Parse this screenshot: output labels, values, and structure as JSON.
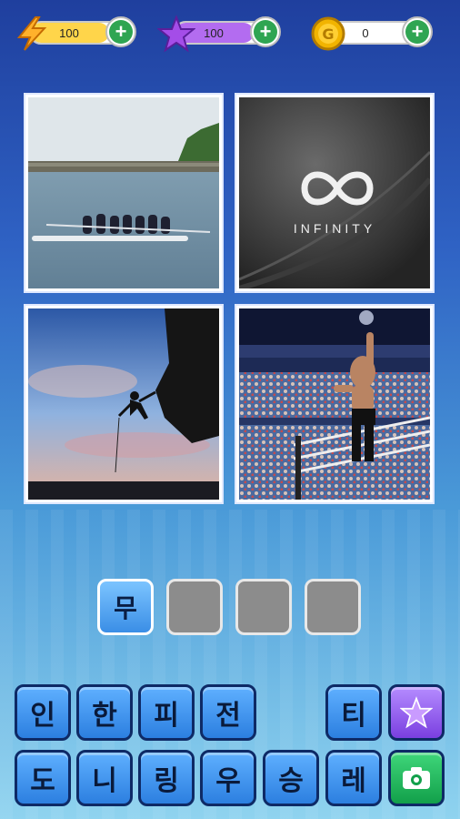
{
  "counters": [
    {
      "icon": "lightning-bolt-icon",
      "value": "100",
      "fill_percent": 80,
      "color": "#ffd54a",
      "icon_color": "#ffb12b"
    },
    {
      "icon": "star-icon",
      "value": "100",
      "fill_percent": 80,
      "color": "#b36cf0",
      "icon_color": "#a44de8"
    },
    {
      "icon": "coin-icon",
      "value": "0",
      "fill_percent": 10,
      "color": "#ffe083",
      "icon_color": "#f2b400"
    }
  ],
  "images": {
    "infinity_text": "INFINITY"
  },
  "answer_slots": [
    "무",
    "",
    "",
    ""
  ],
  "keyboard": {
    "row1": [
      "인",
      "한",
      "피",
      "전",
      "",
      "티"
    ],
    "row2": [
      "도",
      "니",
      "링",
      "우",
      "승",
      "레"
    ]
  },
  "colors": {
    "key_blue": "#3a8ee6",
    "key_border": "#0e2a66",
    "star_button": "#7a3fe0",
    "camera_button": "#12a04a"
  }
}
